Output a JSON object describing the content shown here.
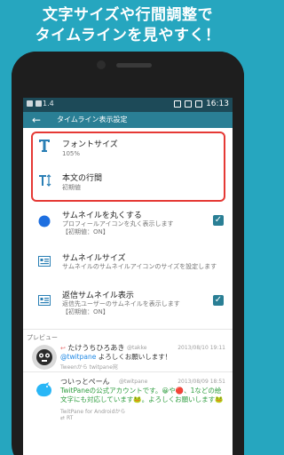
{
  "headline": {
    "line1": "文字サイズや行間調整で",
    "line2": "タイムラインを見やすく！"
  },
  "statusbar": {
    "left_text": "1.4",
    "time": "16:13"
  },
  "appbar": {
    "back": "←",
    "title": "タイムライン表示設定"
  },
  "settings": [
    {
      "title": "フォントサイズ",
      "subtitle": "105%",
      "icon": "font-size-icon"
    },
    {
      "title": "本文の行間",
      "subtitle": "初期値",
      "icon": "line-spacing-icon"
    },
    {
      "title": "サムネイルを丸くする",
      "subtitle": "プロフィールアイコンを丸く表示します",
      "subtitle2": "【初期値：ON】",
      "icon": "circle-icon",
      "checked": true
    },
    {
      "title": "サムネイルサイズ",
      "subtitle": "サムネイルのサムネイルアイコンのサイズを設定します",
      "icon": "thumbnail-icon"
    },
    {
      "title": "返信サムネイル表示",
      "subtitle": "返信先ユーザーのサムネイルを表示します",
      "subtitle2": "【初期値：ON】",
      "icon": "reply-thumbnail-icon",
      "checked": true
    }
  ],
  "preview": {
    "label": "プレビュー",
    "tweets": [
      {
        "name": "たけうちひろあき",
        "handle": "@takke",
        "date": "2013/08/10 19:11",
        "mention": "@twitpane",
        "text": " よろしくお願いします！",
        "via": "Tweenから twitpane宛"
      },
      {
        "name": "ついっとぺーん",
        "handle": "@twitpane",
        "date": "2013/08/09 18:51",
        "text_green": "TwitPaneの公式アカウントです。",
        "text_rest": "😀や🔴、1などの絵文字にも対応しています🐸。よろしくお願いします🐸",
        "via": "TwitPane for Androidから",
        "rt": "RT"
      }
    ]
  },
  "colors": {
    "accent": "#2a7f95",
    "highlight": "#e53935",
    "background": "#26a6bf"
  }
}
